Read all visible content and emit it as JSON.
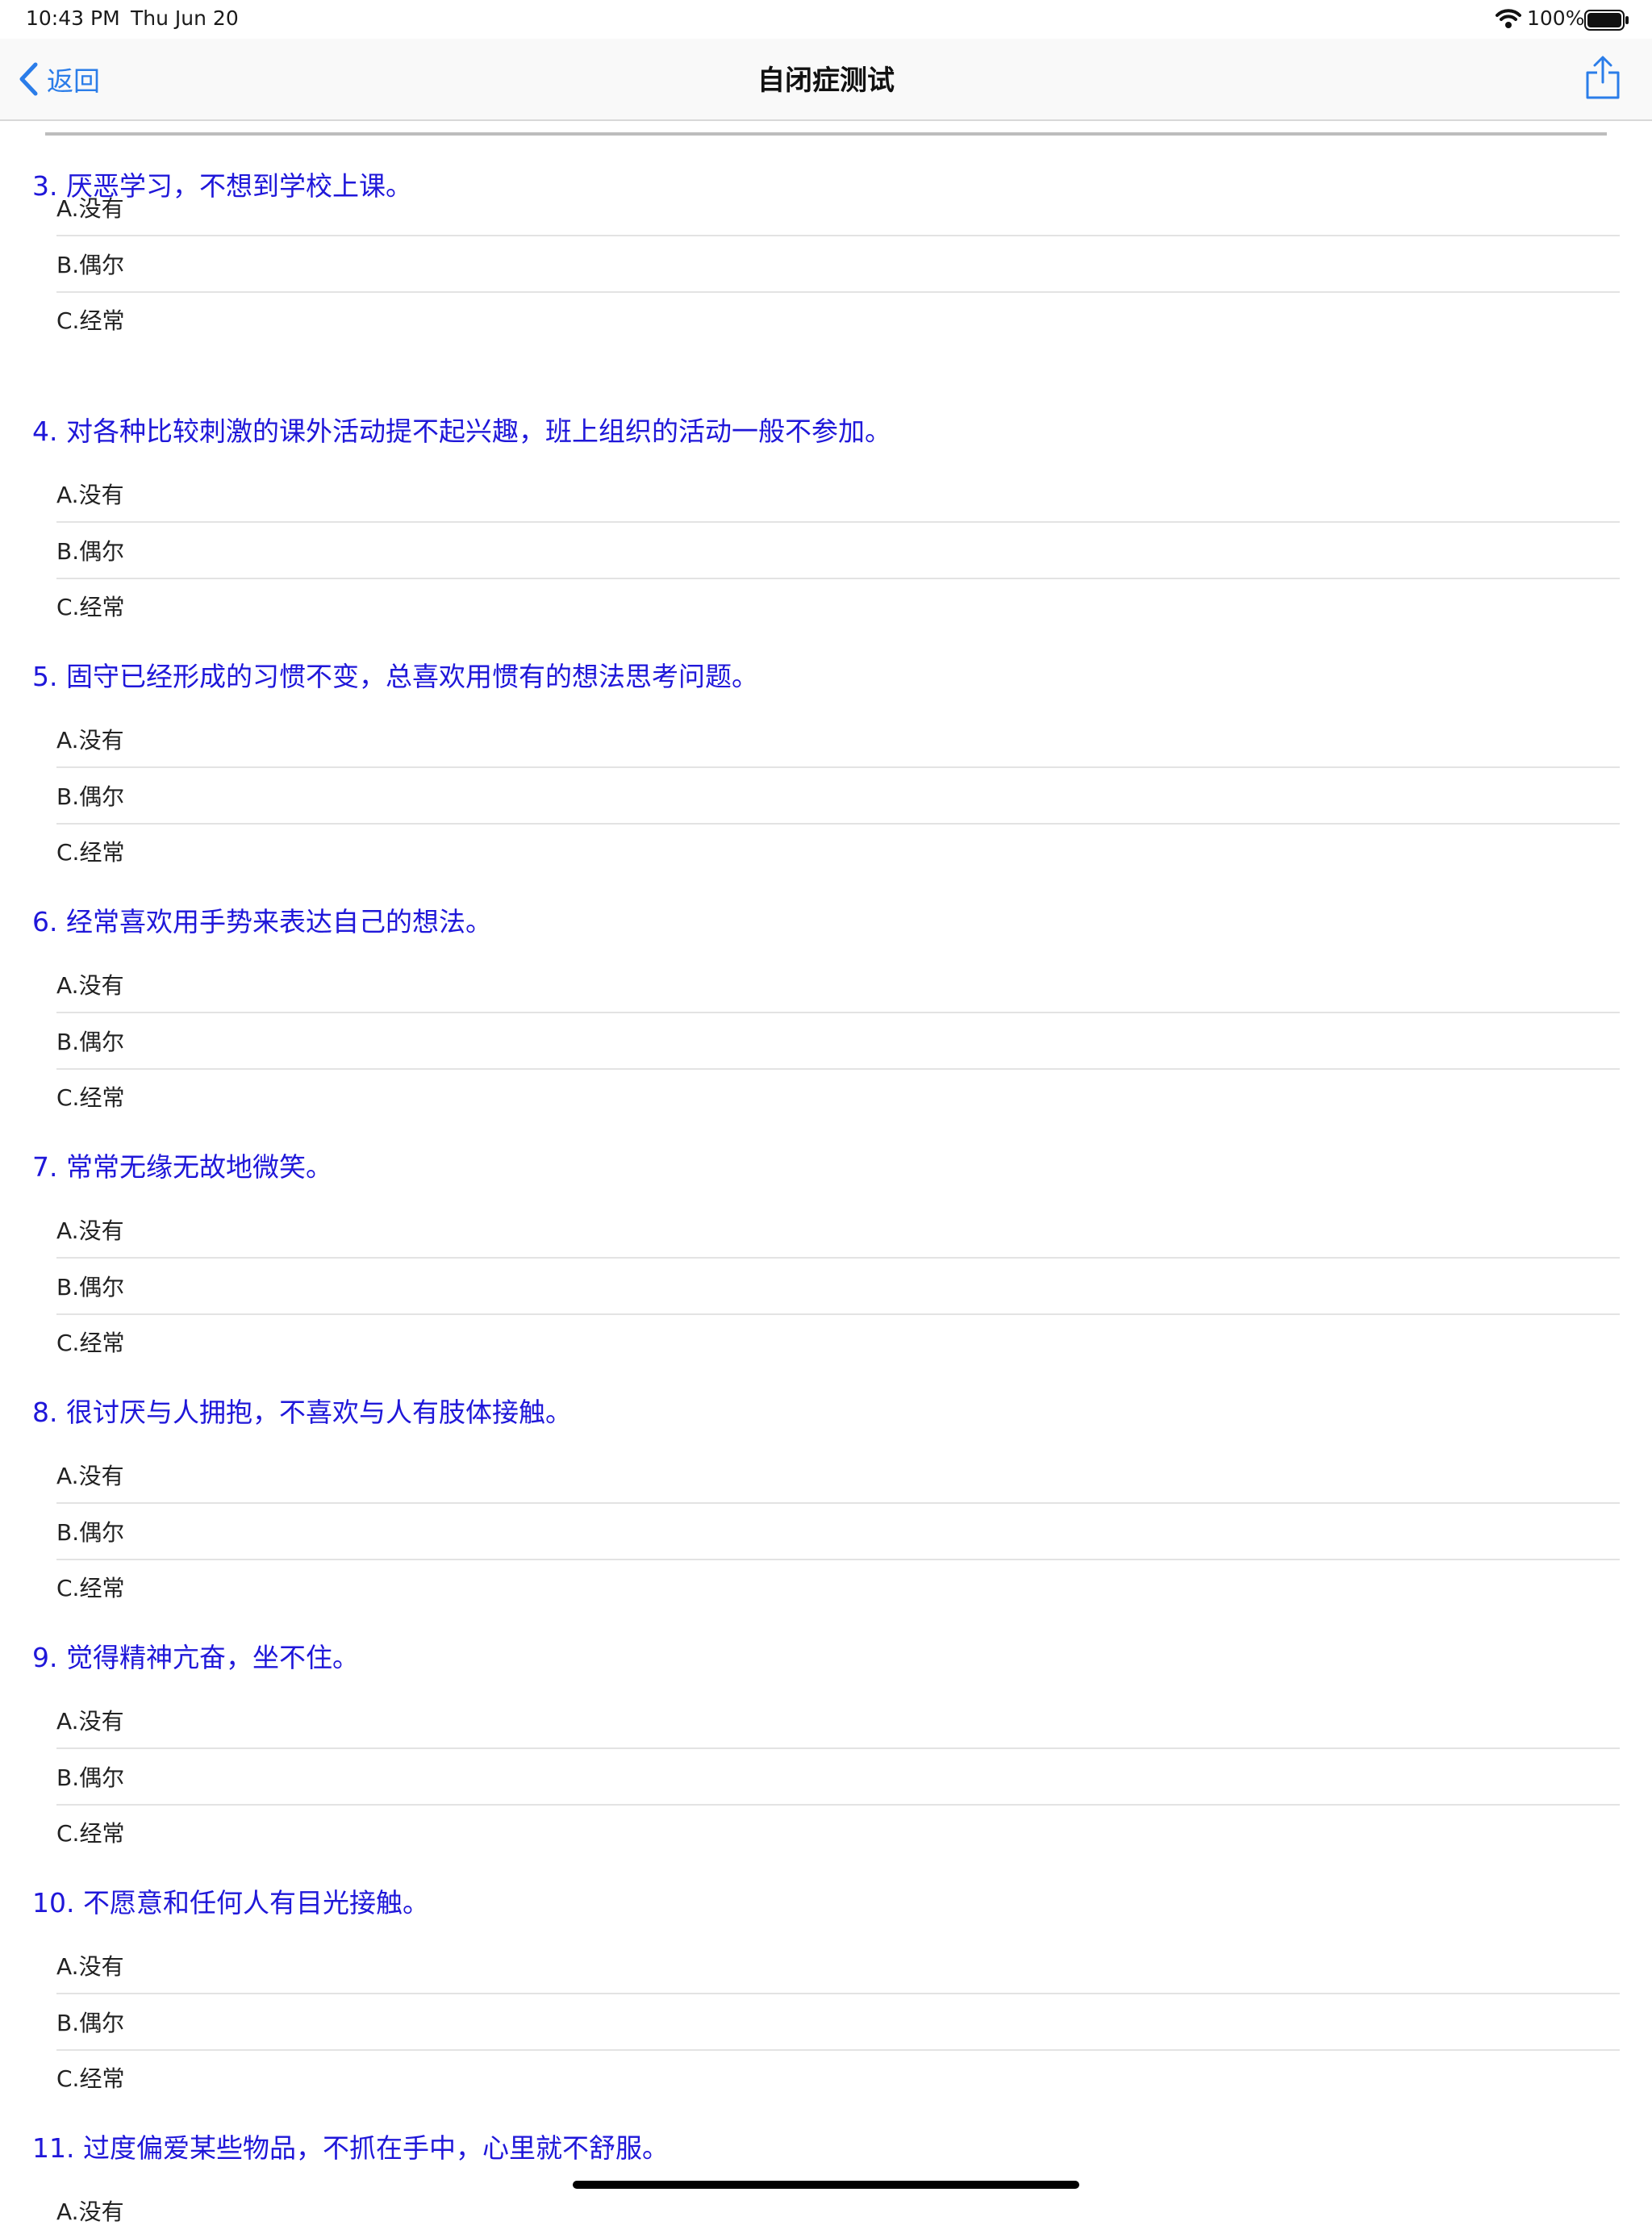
{
  "status": {
    "time": "10:43 PM",
    "date": "Thu Jun 20",
    "battery": "100%",
    "icons": [
      "wifi-icon",
      "battery-icon"
    ]
  },
  "nav": {
    "back_label": "返回",
    "title": "自闭症测试",
    "icons": [
      "chevron-left-icon",
      "share-icon"
    ],
    "accent": "#2b7de9"
  },
  "colors": {
    "question": "#1f17d9"
  },
  "questions": [
    {
      "text": "3.  厌恶学习，不想到学校上课。",
      "options": [
        "A.没有",
        "B.偶尔",
        "C.经常"
      ]
    },
    {
      "text": "4.  对各种比较刺激的课外活动提不起兴趣，班上组织的活动一般不参加。",
      "options": [
        "A.没有",
        "B.偶尔",
        "C.经常"
      ]
    },
    {
      "text": "5.  固守已经形成的习惯不变，总喜欢用惯有的想法思考问题。",
      "options": [
        "A.没有",
        "B.偶尔",
        "C.经常"
      ]
    },
    {
      "text": "6.  经常喜欢用手势来表达自己的想法。",
      "options": [
        "A.没有",
        "B.偶尔",
        "C.经常"
      ]
    },
    {
      "text": "7.  常常无缘无故地微笑。",
      "options": [
        "A.没有",
        "B.偶尔",
        "C.经常"
      ]
    },
    {
      "text": "8.  很讨厌与人拥抱，不喜欢与人有肢体接触。",
      "options": [
        "A.没有",
        "B.偶尔",
        "C.经常"
      ]
    },
    {
      "text": "9.  觉得精神亢奋，坐不住。",
      "options": [
        "A.没有",
        "B.偶尔",
        "C.经常"
      ]
    },
    {
      "text": "10.  不愿意和任何人有目光接触。",
      "options": [
        "A.没有",
        "B.偶尔",
        "C.经常"
      ]
    },
    {
      "text": "11.  过度偏爱某些物品，不抓在手中，心里就不舒服。",
      "options": [
        "A.没有"
      ]
    }
  ]
}
